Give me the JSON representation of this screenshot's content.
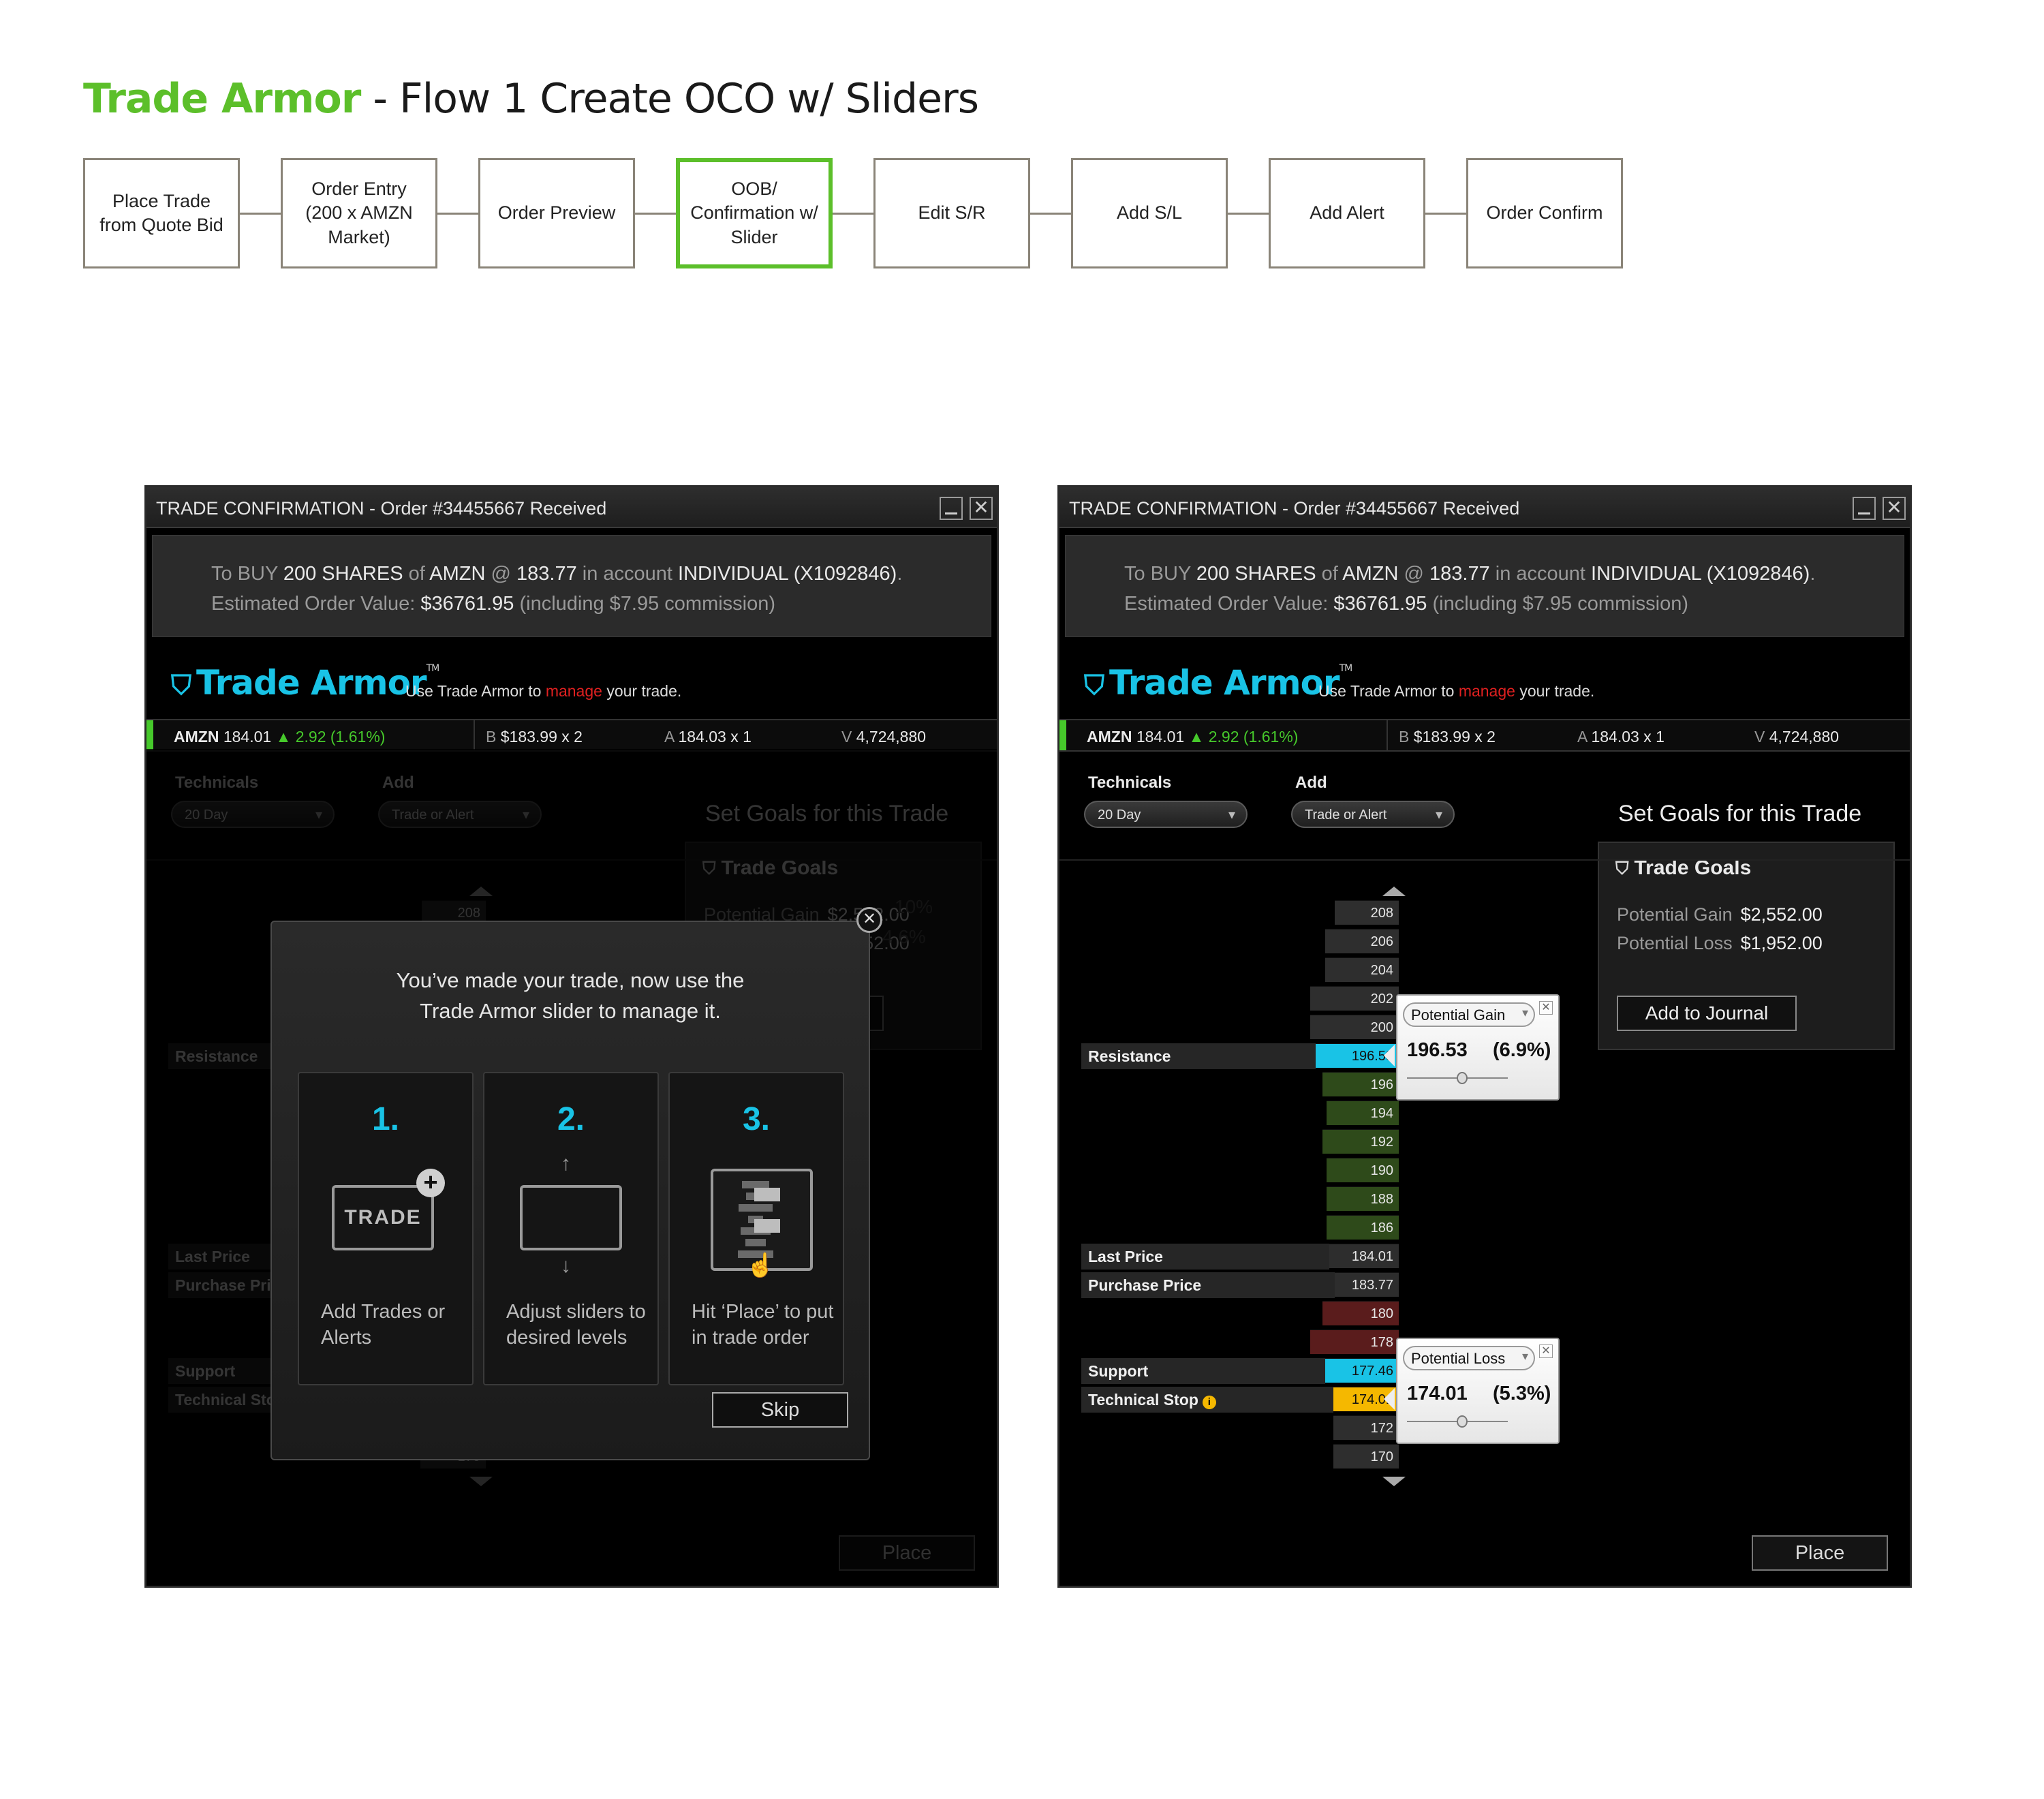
{
  "page_title": {
    "brand": "Trade Armor",
    "rest": " - Flow 1 Create OCO w/ Sliders"
  },
  "flow_steps": [
    {
      "label": "Place Trade\nfrom Quote Bid",
      "active": false
    },
    {
      "label": "Order Entry\n(200 x AMZN\nMarket)",
      "active": false
    },
    {
      "label": "Order Preview",
      "active": false
    },
    {
      "label": "OOB/\nConfirmation w/\nSlider",
      "active": true
    },
    {
      "label": "Edit S/R",
      "active": false
    },
    {
      "label": "Add S/L",
      "active": false
    },
    {
      "label": "Add Alert",
      "active": false
    },
    {
      "label": "Order Confirm",
      "active": false
    }
  ],
  "window": {
    "title": "TRADE CONFIRMATION - Order #34455667 Received",
    "summary": {
      "l1": {
        "a": "To BUY ",
        "b": "200 SHARES",
        "c": " of ",
        "d": "AMZN",
        "e": " @ ",
        "f": "183.77",
        "g": " in account ",
        "h": "INDIVIDUAL (X1092846)",
        "i": "."
      },
      "l2": {
        "a": "Estimated Order Value: ",
        "b": "$36761.95",
        "c": " (including $7.95 commission)"
      }
    },
    "brand": "Trade Armor",
    "tm": "TM",
    "tagline": {
      "a": "Use Trade Armor to ",
      "b": "manage",
      "c": " your trade."
    },
    "quote": {
      "symbol": "AMZN",
      "last": "184.01",
      "change": "2.92 (1.61%)",
      "bid_label": "B",
      "bid": "$183.99 x 2",
      "ask_label": "A",
      "ask": "184.03 x 1",
      "vol_label": "V",
      "vol": "4,724,880"
    },
    "technicals_label": "Technicals",
    "technicals_value": "20 Day",
    "add_label": "Add",
    "add_value": "Trade or Alert",
    "goals_heading": "Set Goals for this Trade",
    "goals": {
      "title": "Trade Goals",
      "gain_label": "Potential Gain",
      "gain": "$2,552.00",
      "loss_label": "Potential Loss",
      "loss": "$1,952.00",
      "journal": "Add to Journal"
    },
    "ladder": [
      "208",
      "206",
      "204",
      "202",
      "200",
      "196.53",
      "196",
      "194",
      "192",
      "190",
      "188",
      "186",
      "184.01",
      "183.77",
      "180",
      "178",
      "177.46",
      "174.01",
      "172",
      "170"
    ],
    "row_labels": {
      "resistance": "Resistance",
      "last": "Last Price",
      "purchase": "Purchase Price",
      "support": "Support",
      "stop": "Technical Stop"
    },
    "pop_gain": {
      "select": "Potential Gain",
      "value": "196.53",
      "pct": "(6.9%)",
      "level": 0.55
    },
    "pop_loss": {
      "select": "Potential Loss",
      "value": "174.01",
      "pct": "(5.3%)",
      "level": 0.55
    },
    "place": "Place",
    "hidden_goal_pcts": {
      "a": "10%",
      "b": "4 6%"
    }
  },
  "modal": {
    "text": "You’ve made your trade, now use the\nTrade Armor slider to manage it.",
    "cards": [
      {
        "num": "1.",
        "desc": "Add Trades or Alerts",
        "icon_text": "TRADE"
      },
      {
        "num": "2.",
        "desc": "Adjust sliders to desired levels"
      },
      {
        "num": "3.",
        "desc": "Hit ‘Place’ to put in trade order"
      }
    ],
    "skip": "Skip"
  },
  "colors": {
    "brand_green": "#5cbf2a",
    "cyan": "#19c3e6",
    "gold": "#f5b800",
    "red": "#e02020"
  }
}
